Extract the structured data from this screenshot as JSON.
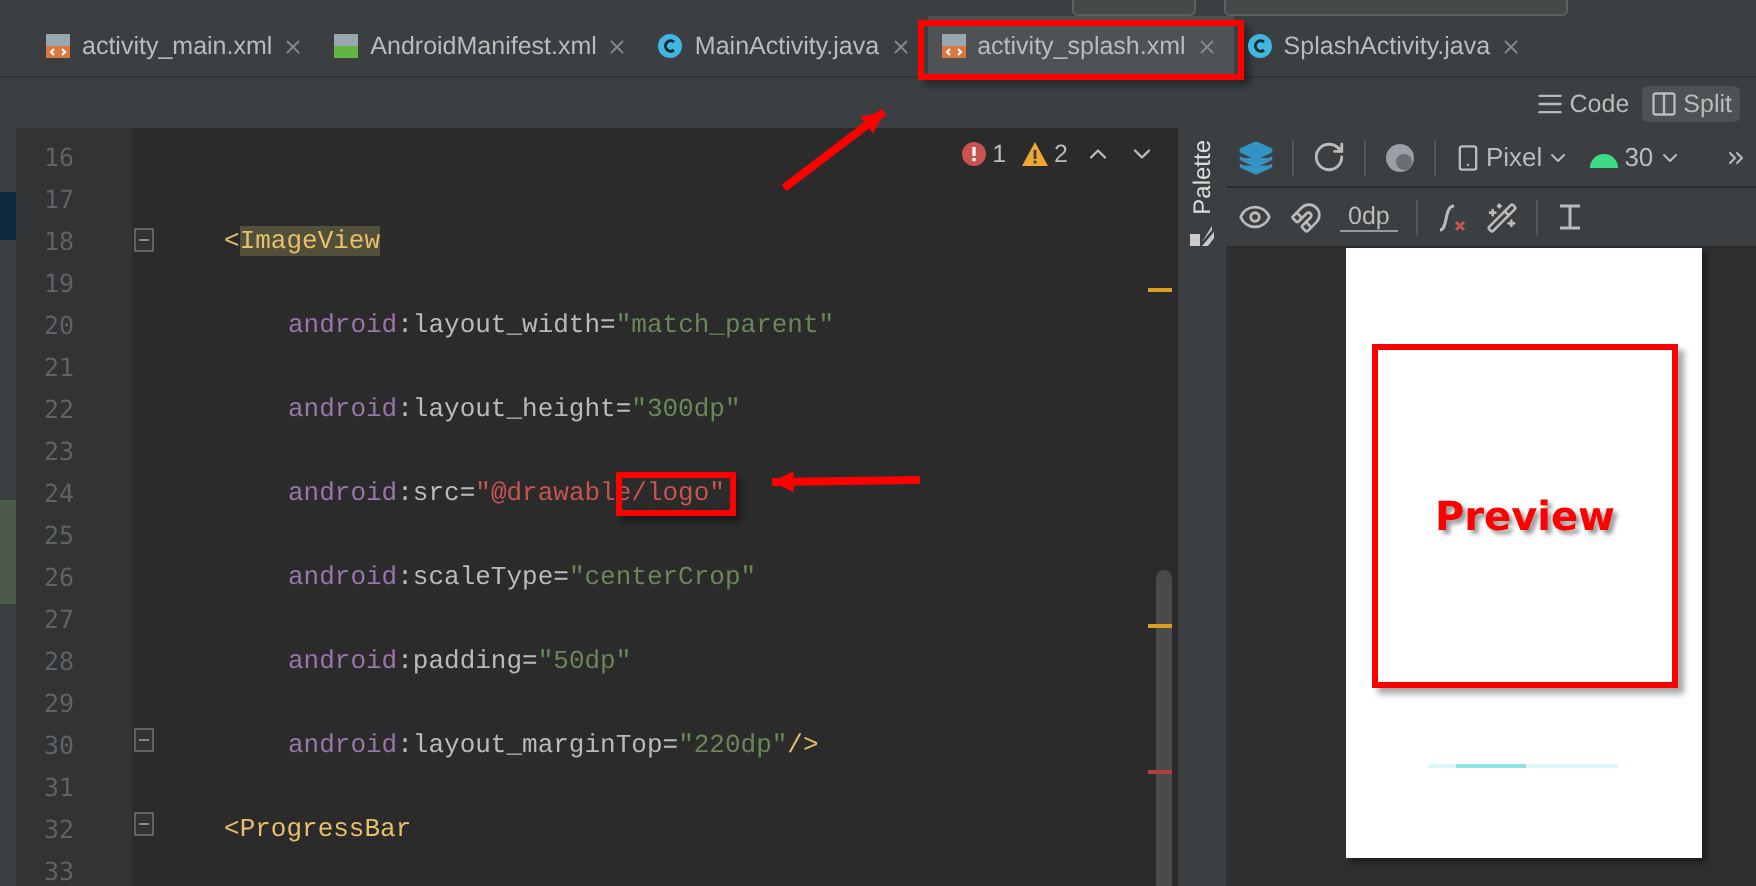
{
  "tabs": [
    {
      "label": "activity_main.xml",
      "kind": "xml",
      "selected": false
    },
    {
      "label": "AndroidManifest.xml",
      "kind": "manifest",
      "selected": false
    },
    {
      "label": "MainActivity.java",
      "kind": "java",
      "selected": false
    },
    {
      "label": "activity_splash.xml",
      "kind": "xml",
      "selected": true
    },
    {
      "label": "SplashActivity.java",
      "kind": "java",
      "selected": false
    }
  ],
  "view_modes": [
    {
      "label": "Code",
      "kind": "code",
      "selected": false
    },
    {
      "label": "Split",
      "kind": "split",
      "selected": true
    }
  ],
  "inspections": {
    "errors": "1",
    "warnings": "2"
  },
  "editor": {
    "lines": [
      {
        "number": "16",
        "kind": "blank",
        "fold": false
      },
      {
        "number": "17",
        "kind": "blank",
        "fold": false
      },
      {
        "number": "18",
        "kind": "tag",
        "fold": true,
        "bracket": "<",
        "name": "ImageView",
        "highlighted": true
      },
      {
        "number": "19",
        "kind": "blank",
        "fold": false
      },
      {
        "number": "20",
        "kind": "attribute",
        "fold": false,
        "namespace": "android",
        "colon": ":",
        "attribute": "layout_width",
        "equals": "=",
        "value": "\"match_parent\"",
        "error": false
      },
      {
        "number": "21",
        "kind": "blank",
        "fold": false
      },
      {
        "number": "22",
        "kind": "attribute",
        "fold": false,
        "namespace": "android",
        "colon": ":",
        "attribute": "layout_height",
        "equals": "=",
        "value": "\"300dp\"",
        "error": false
      },
      {
        "number": "23",
        "kind": "blank",
        "fold": false
      },
      {
        "number": "24",
        "kind": "attribute",
        "fold": false,
        "namespace": "android",
        "colon": ":",
        "attribute": "src",
        "equals": "=",
        "value": "\"@drawable/logo\"",
        "error": true
      },
      {
        "number": "25",
        "kind": "blank",
        "fold": false
      },
      {
        "number": "26",
        "kind": "attribute",
        "fold": false,
        "namespace": "android",
        "colon": ":",
        "attribute": "scaleType",
        "equals": "=",
        "value": "\"centerCrop\"",
        "error": false
      },
      {
        "number": "27",
        "kind": "blank",
        "fold": false
      },
      {
        "number": "28",
        "kind": "attribute",
        "fold": false,
        "namespace": "android",
        "colon": ":",
        "attribute": "padding",
        "equals": "=",
        "value": "\"50dp\"",
        "error": false
      },
      {
        "number": "29",
        "kind": "blank",
        "fold": false
      },
      {
        "number": "30",
        "kind": "attribute",
        "fold": true,
        "namespace": "android",
        "colon": ":",
        "attribute": "layout_marginTop",
        "equals": "=",
        "value": "\"220dp\"",
        "end": "/>",
        "error": false
      },
      {
        "number": "31",
        "kind": "blank",
        "fold": false
      },
      {
        "number": "32",
        "kind": "tag",
        "fold": true,
        "bracket": "<",
        "name": "ProgressBar",
        "highlighted": false
      },
      {
        "number": "33",
        "kind": "blank",
        "fold": false
      }
    ]
  },
  "palette": {
    "label": "Palette"
  },
  "design_toolbar": {
    "device": "Pixel",
    "api": "30",
    "margin": "0dp"
  },
  "preview": {
    "progress": {
      "level": 0.37
    },
    "annotation": "Preview"
  }
}
